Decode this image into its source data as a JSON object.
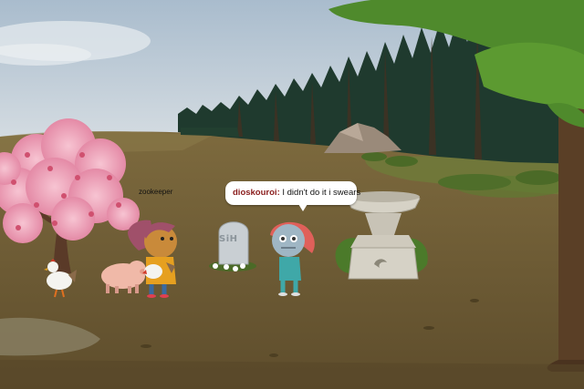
{
  "players": [
    {
      "name": "zookeeper"
    }
  ],
  "chat": {
    "speaker": "dioskouroi",
    "separator": ":",
    "message": " I didn't do it i swears"
  },
  "objects": {
    "tombstone_text": "SiH"
  },
  "colors": {
    "sky": "#b9c9d9",
    "ground": "#6b5a33",
    "forest": "#1f3a2e",
    "speaker_name": "#8a1c1c"
  }
}
